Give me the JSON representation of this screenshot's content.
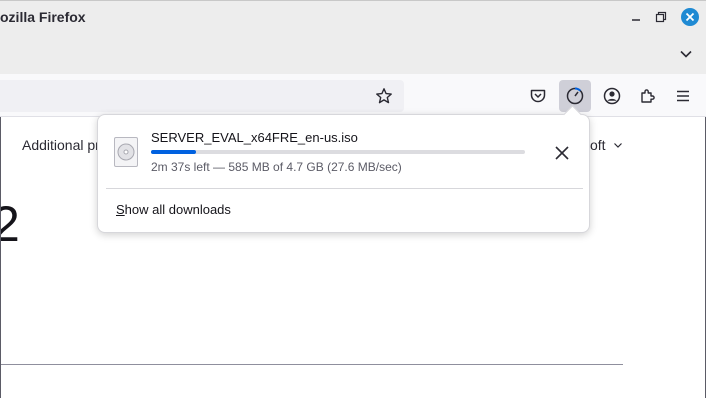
{
  "window": {
    "title": "ozilla Firefox"
  },
  "content": {
    "additional_text": "Additional pr",
    "big_digit": "2",
    "right_text": "oft"
  },
  "downloads_panel": {
    "file_name": "SERVER_EVAL_x64FRE_en-us.iso",
    "progress": 0.12,
    "status": "2m 37s left — 585 MB of 4.7 GB (27.6 MB/sec)",
    "show_all_accesskey": "S",
    "show_all_rest": "how all downloads"
  },
  "colors": {
    "progress": "#0061e0",
    "close_button": "#1f8ad3"
  }
}
